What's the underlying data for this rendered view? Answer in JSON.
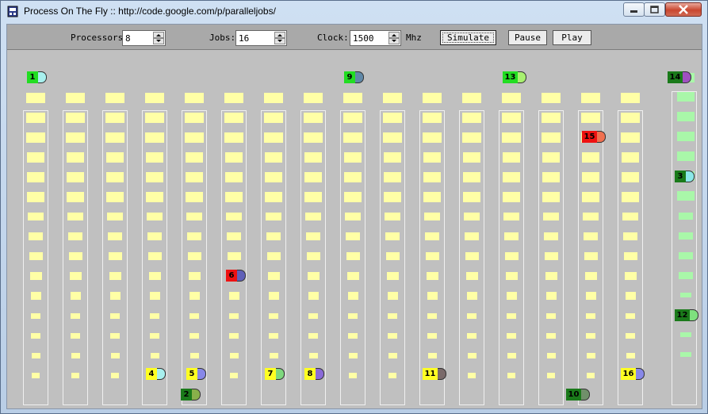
{
  "window": {
    "title": "Process On The Fly :: http://code.google.com/p/paralleljobs/"
  },
  "toolbar": {
    "processors_label": "Processors:",
    "processors_value": "8",
    "jobs_label": "Jobs:",
    "jobs_value": "16",
    "clock_label": "Clock:",
    "clock_value": "1500",
    "clock_unit": "Mhz",
    "simulate_label": "Simulate",
    "pause_label": "Pause",
    "play_label": "Play"
  },
  "colors": {
    "yellow_cell": "#ffffa6",
    "green_cell": "#a9f7a9",
    "job_green": "#22dd22",
    "job_darkgreen": "#1a7a1a",
    "job_yellow": "#ffff22",
    "job_red": "#ee1111"
  },
  "jobs": [
    {
      "id": "1",
      "label": "1",
      "status": "ready",
      "color": "#22dd22",
      "cap": "#a8f0ee"
    },
    {
      "id": "2",
      "label": "2",
      "status": "done",
      "color": "#1a7a1a",
      "cap": "#88b04a"
    },
    {
      "id": "3",
      "label": "3",
      "status": "finished",
      "color": "#1a7a1a",
      "cap": "#8be8e8"
    },
    {
      "id": "4",
      "label": "4",
      "status": "running",
      "color": "#ffff22",
      "cap": "#a8f0ee"
    },
    {
      "id": "5",
      "label": "5",
      "status": "running",
      "color": "#ffff22",
      "cap": "#8888e8"
    },
    {
      "id": "6",
      "label": "6",
      "status": "blocked",
      "color": "#ee1111",
      "cap": "#6060b8"
    },
    {
      "id": "7",
      "label": "7",
      "status": "running",
      "color": "#ffff22",
      "cap": "#7ed87e"
    },
    {
      "id": "8",
      "label": "8",
      "status": "running",
      "color": "#ffff22",
      "cap": "#8a6ad8"
    },
    {
      "id": "9",
      "label": "9",
      "status": "ready",
      "color": "#22dd22",
      "cap": "#6088a8"
    },
    {
      "id": "10",
      "label": "10",
      "status": "done",
      "color": "#1a7a1a",
      "cap": "#70906a"
    },
    {
      "id": "11",
      "label": "11",
      "status": "running",
      "color": "#ffff22",
      "cap": "#7a6a6a"
    },
    {
      "id": "12",
      "label": "12",
      "status": "finished",
      "color": "#1a7a1a",
      "cap": "#7ee07e"
    },
    {
      "id": "13",
      "label": "13",
      "status": "ready",
      "color": "#22dd22",
      "cap": "#a8f070"
    },
    {
      "id": "14",
      "label": "14",
      "status": "finished",
      "color": "#1a7a1a",
      "cap": "#a050c0"
    },
    {
      "id": "15",
      "label": "15",
      "status": "blocked",
      "color": "#ee1111",
      "cap": "#f07050"
    },
    {
      "id": "16",
      "label": "16",
      "status": "running",
      "color": "#ffff22",
      "cap": "#8888e8"
    }
  ]
}
